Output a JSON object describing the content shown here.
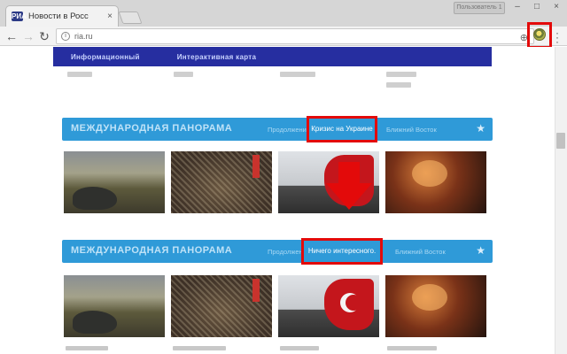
{
  "browser": {
    "tab_title": "Новости в Росс",
    "tab_favicon": "РИА",
    "user_label": "Пользователь 1",
    "address": "ria.ru",
    "icons": [
      "back-icon",
      "forward-icon",
      "reload-icon",
      "info-icon",
      "translate-icon",
      "extension-icon",
      "menu-icon"
    ]
  },
  "site": {
    "nav": [
      "Информационный",
      "Интерактивная карта"
    ],
    "sections": [
      {
        "title": "МЕЖДУНАРОДНАЯ ПАНОРАМА",
        "links": [
          "Продолжение"
        ],
        "badge": "Кризис на Украине",
        "after": "Ближний Восток"
      },
      {
        "title": "МЕЖДУНАРОДНАЯ ПАНОРАМА",
        "links": [
          "Продолжение"
        ],
        "badge": "Ничего интересного.",
        "after": "Ближний Восток"
      }
    ]
  },
  "colors": {
    "accent": "#2f9ad8",
    "nav": "#262ea0",
    "highlight": "#e30a0a"
  }
}
